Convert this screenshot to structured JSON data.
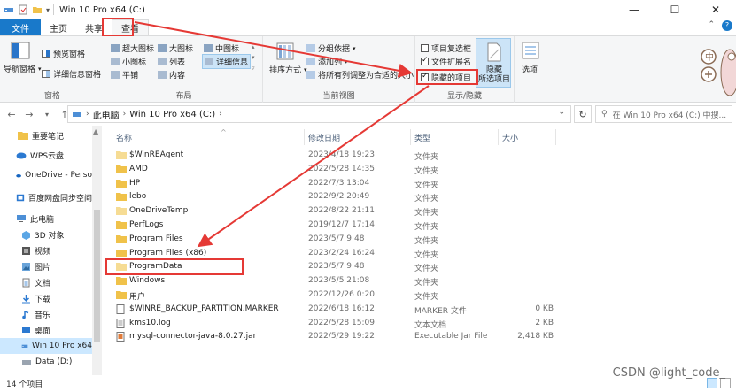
{
  "window": {
    "title": "Win 10 Pro x64 (C:)",
    "controls": [
      "—",
      "☐",
      "✕"
    ]
  },
  "tabs": [
    {
      "label": "文件"
    },
    {
      "label": "主页"
    },
    {
      "label": "共享"
    },
    {
      "label": "查看"
    }
  ],
  "ribbon": {
    "panes": {
      "nav_pane": "导航窗格",
      "preview_pane": "预览窗格",
      "details_pane": "详细信息窗格",
      "label": "窗格"
    },
    "layout": {
      "items": [
        "超大图标",
        "大图标",
        "中图标",
        "小图标",
        "列表",
        "详细信息",
        "平铺",
        "内容"
      ],
      "label": "布局"
    },
    "current_view": {
      "sort_by": "排序方式",
      "group_by": "分组依据",
      "add_columns": "添加列",
      "fit_columns": "将所有列调整为合适的大小",
      "label": "当前视图"
    },
    "show_hide": {
      "item_checkboxes": "项目复选框",
      "file_extensions": "文件扩展名",
      "hidden_items": "隐藏的项目",
      "hide_selected_line1": "隐藏",
      "hide_selected_line2": "所选项目",
      "label": "显示/隐藏"
    },
    "options": "选项"
  },
  "address": {
    "crumbs": [
      "此电脑",
      "Win 10 Pro x64 (C:)"
    ],
    "search_placeholder": "在 Win 10 Pro x64 (C:) 中搜..."
  },
  "nav": {
    "items": [
      {
        "label": "重要笔记"
      },
      {
        "label": "WPS云盘"
      },
      {
        "label": "OneDrive - Perso"
      },
      {
        "label": "百度网盘同步空间"
      },
      {
        "label": "此电脑"
      },
      {
        "label": "3D 对象"
      },
      {
        "label": "视频"
      },
      {
        "label": "图片"
      },
      {
        "label": "文档"
      },
      {
        "label": "下载"
      },
      {
        "label": "音乐"
      },
      {
        "label": "桌面"
      },
      {
        "label": "Win 10 Pro x64"
      },
      {
        "label": "Data (D:)"
      }
    ]
  },
  "columns": {
    "name": "名称",
    "date": "修改日期",
    "type": "类型",
    "size": "大小"
  },
  "files": [
    {
      "name": "$WinREAgent",
      "date": "2023/4/18 19:23",
      "type": "文件夹",
      "size": "",
      "kind": "folder",
      "faded": true
    },
    {
      "name": "AMD",
      "date": "2022/5/28 14:35",
      "type": "文件夹",
      "size": "",
      "kind": "folder",
      "faded": false
    },
    {
      "name": "HP",
      "date": "2022/7/3 13:04",
      "type": "文件夹",
      "size": "",
      "kind": "folder",
      "faded": false
    },
    {
      "name": "lebo",
      "date": "2022/9/2 20:49",
      "type": "文件夹",
      "size": "",
      "kind": "folder",
      "faded": false
    },
    {
      "name": "OneDriveTemp",
      "date": "2022/8/22 21:11",
      "type": "文件夹",
      "size": "",
      "kind": "folder",
      "faded": true
    },
    {
      "name": "PerfLogs",
      "date": "2019/12/7 17:14",
      "type": "文件夹",
      "size": "",
      "kind": "folder",
      "faded": false
    },
    {
      "name": "Program Files",
      "date": "2023/5/7 9:48",
      "type": "文件夹",
      "size": "",
      "kind": "folder",
      "faded": false
    },
    {
      "name": "Program Files (x86)",
      "date": "2023/2/24 16:24",
      "type": "文件夹",
      "size": "",
      "kind": "folder",
      "faded": false
    },
    {
      "name": "ProgramData",
      "date": "2023/5/7 9:48",
      "type": "文件夹",
      "size": "",
      "kind": "folder",
      "faded": true
    },
    {
      "name": "Windows",
      "date": "2023/5/5 21:08",
      "type": "文件夹",
      "size": "",
      "kind": "folder",
      "faded": false
    },
    {
      "name": "用户",
      "date": "2022/12/26 0:20",
      "type": "文件夹",
      "size": "",
      "kind": "folder",
      "faded": false
    },
    {
      "name": "$WINRE_BACKUP_PARTITION.MARKER",
      "date": "2022/6/18 16:12",
      "type": "MARKER 文件",
      "size": "0 KB",
      "kind": "file",
      "faded": false
    },
    {
      "name": "kms10.log",
      "date": "2022/5/28 15:09",
      "type": "文本文档",
      "size": "2 KB",
      "kind": "text",
      "faded": false
    },
    {
      "name": "mysql-connector-java-8.0.27.jar",
      "date": "2022/5/29 19:22",
      "type": "Executable Jar File",
      "size": "2,418 KB",
      "kind": "jar",
      "faded": false
    }
  ],
  "status": {
    "count": "14 个项目"
  },
  "watermark": "CSDN @light_code_",
  "colors": {
    "accent": "#1979ca",
    "annotation": "#e53935",
    "folder": "#f0c24a",
    "selection": "#cce8ff"
  }
}
